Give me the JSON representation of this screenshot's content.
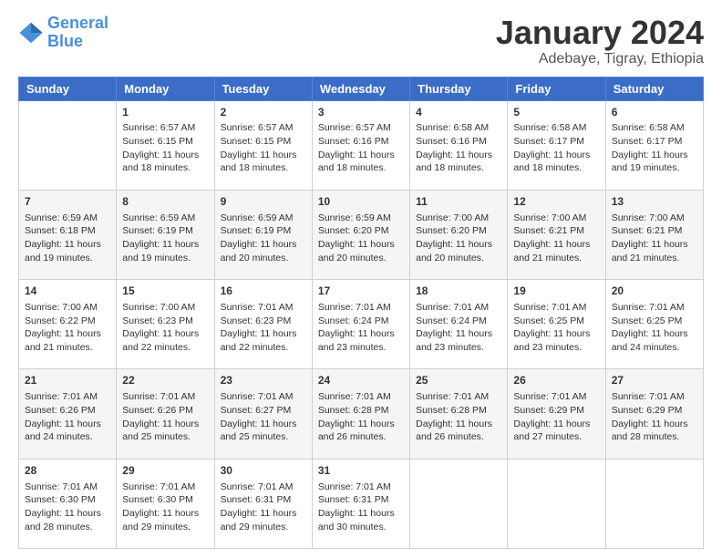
{
  "logo": {
    "line1": "General",
    "line2": "Blue"
  },
  "title": "January 2024",
  "subtitle": "Adebaye, Tigray, Ethiopia",
  "headers": [
    "Sunday",
    "Monday",
    "Tuesday",
    "Wednesday",
    "Thursday",
    "Friday",
    "Saturday"
  ],
  "weeks": [
    [
      {
        "date": "",
        "lines": []
      },
      {
        "date": "1",
        "lines": [
          "Sunrise: 6:57 AM",
          "Sunset: 6:15 PM",
          "Daylight: 11 hours",
          "and 18 minutes."
        ]
      },
      {
        "date": "2",
        "lines": [
          "Sunrise: 6:57 AM",
          "Sunset: 6:15 PM",
          "Daylight: 11 hours",
          "and 18 minutes."
        ]
      },
      {
        "date": "3",
        "lines": [
          "Sunrise: 6:57 AM",
          "Sunset: 6:16 PM",
          "Daylight: 11 hours",
          "and 18 minutes."
        ]
      },
      {
        "date": "4",
        "lines": [
          "Sunrise: 6:58 AM",
          "Sunset: 6:16 PM",
          "Daylight: 11 hours",
          "and 18 minutes."
        ]
      },
      {
        "date": "5",
        "lines": [
          "Sunrise: 6:58 AM",
          "Sunset: 6:17 PM",
          "Daylight: 11 hours",
          "and 18 minutes."
        ]
      },
      {
        "date": "6",
        "lines": [
          "Sunrise: 6:58 AM",
          "Sunset: 6:17 PM",
          "Daylight: 11 hours",
          "and 19 minutes."
        ]
      }
    ],
    [
      {
        "date": "7",
        "lines": [
          "Sunrise: 6:59 AM",
          "Sunset: 6:18 PM",
          "Daylight: 11 hours",
          "and 19 minutes."
        ]
      },
      {
        "date": "8",
        "lines": [
          "Sunrise: 6:59 AM",
          "Sunset: 6:19 PM",
          "Daylight: 11 hours",
          "and 19 minutes."
        ]
      },
      {
        "date": "9",
        "lines": [
          "Sunrise: 6:59 AM",
          "Sunset: 6:19 PM",
          "Daylight: 11 hours",
          "and 20 minutes."
        ]
      },
      {
        "date": "10",
        "lines": [
          "Sunrise: 6:59 AM",
          "Sunset: 6:20 PM",
          "Daylight: 11 hours",
          "and 20 minutes."
        ]
      },
      {
        "date": "11",
        "lines": [
          "Sunrise: 7:00 AM",
          "Sunset: 6:20 PM",
          "Daylight: 11 hours",
          "and 20 minutes."
        ]
      },
      {
        "date": "12",
        "lines": [
          "Sunrise: 7:00 AM",
          "Sunset: 6:21 PM",
          "Daylight: 11 hours",
          "and 21 minutes."
        ]
      },
      {
        "date": "13",
        "lines": [
          "Sunrise: 7:00 AM",
          "Sunset: 6:21 PM",
          "Daylight: 11 hours",
          "and 21 minutes."
        ]
      }
    ],
    [
      {
        "date": "14",
        "lines": [
          "Sunrise: 7:00 AM",
          "Sunset: 6:22 PM",
          "Daylight: 11 hours",
          "and 21 minutes."
        ]
      },
      {
        "date": "15",
        "lines": [
          "Sunrise: 7:00 AM",
          "Sunset: 6:23 PM",
          "Daylight: 11 hours",
          "and 22 minutes."
        ]
      },
      {
        "date": "16",
        "lines": [
          "Sunrise: 7:01 AM",
          "Sunset: 6:23 PM",
          "Daylight: 11 hours",
          "and 22 minutes."
        ]
      },
      {
        "date": "17",
        "lines": [
          "Sunrise: 7:01 AM",
          "Sunset: 6:24 PM",
          "Daylight: 11 hours",
          "and 23 minutes."
        ]
      },
      {
        "date": "18",
        "lines": [
          "Sunrise: 7:01 AM",
          "Sunset: 6:24 PM",
          "Daylight: 11 hours",
          "and 23 minutes."
        ]
      },
      {
        "date": "19",
        "lines": [
          "Sunrise: 7:01 AM",
          "Sunset: 6:25 PM",
          "Daylight: 11 hours",
          "and 23 minutes."
        ]
      },
      {
        "date": "20",
        "lines": [
          "Sunrise: 7:01 AM",
          "Sunset: 6:25 PM",
          "Daylight: 11 hours",
          "and 24 minutes."
        ]
      }
    ],
    [
      {
        "date": "21",
        "lines": [
          "Sunrise: 7:01 AM",
          "Sunset: 6:26 PM",
          "Daylight: 11 hours",
          "and 24 minutes."
        ]
      },
      {
        "date": "22",
        "lines": [
          "Sunrise: 7:01 AM",
          "Sunset: 6:26 PM",
          "Daylight: 11 hours",
          "and 25 minutes."
        ]
      },
      {
        "date": "23",
        "lines": [
          "Sunrise: 7:01 AM",
          "Sunset: 6:27 PM",
          "Daylight: 11 hours",
          "and 25 minutes."
        ]
      },
      {
        "date": "24",
        "lines": [
          "Sunrise: 7:01 AM",
          "Sunset: 6:28 PM",
          "Daylight: 11 hours",
          "and 26 minutes."
        ]
      },
      {
        "date": "25",
        "lines": [
          "Sunrise: 7:01 AM",
          "Sunset: 6:28 PM",
          "Daylight: 11 hours",
          "and 26 minutes."
        ]
      },
      {
        "date": "26",
        "lines": [
          "Sunrise: 7:01 AM",
          "Sunset: 6:29 PM",
          "Daylight: 11 hours",
          "and 27 minutes."
        ]
      },
      {
        "date": "27",
        "lines": [
          "Sunrise: 7:01 AM",
          "Sunset: 6:29 PM",
          "Daylight: 11 hours",
          "and 28 minutes."
        ]
      }
    ],
    [
      {
        "date": "28",
        "lines": [
          "Sunrise: 7:01 AM",
          "Sunset: 6:30 PM",
          "Daylight: 11 hours",
          "and 28 minutes."
        ]
      },
      {
        "date": "29",
        "lines": [
          "Sunrise: 7:01 AM",
          "Sunset: 6:30 PM",
          "Daylight: 11 hours",
          "and 29 minutes."
        ]
      },
      {
        "date": "30",
        "lines": [
          "Sunrise: 7:01 AM",
          "Sunset: 6:31 PM",
          "Daylight: 11 hours",
          "and 29 minutes."
        ]
      },
      {
        "date": "31",
        "lines": [
          "Sunrise: 7:01 AM",
          "Sunset: 6:31 PM",
          "Daylight: 11 hours",
          "and 30 minutes."
        ]
      },
      {
        "date": "",
        "lines": []
      },
      {
        "date": "",
        "lines": []
      },
      {
        "date": "",
        "lines": []
      }
    ]
  ]
}
